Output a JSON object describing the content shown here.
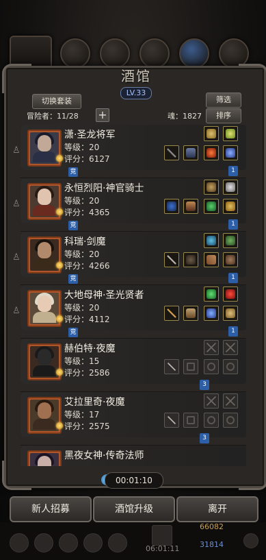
{
  "header": {
    "title": "酒馆",
    "level": "LV.33",
    "switch_outfit_label": "切换套装",
    "filter_label": "筛选",
    "sort_label": "排序",
    "adventurer_label": "冒险者：11/28",
    "soul_label": "魂：1827"
  },
  "heroes": [
    {
      "name": "潇·圣龙将军",
      "level": "等级：20",
      "score": "评分：6127",
      "tag": "竞",
      "badge": "1"
    },
    {
      "name": "永恒烈阳·神官骑士",
      "level": "等级：20",
      "score": "评分：4365",
      "tag": "竞",
      "badge": "1"
    },
    {
      "name": "科瑞·剑魔",
      "level": "等级：20",
      "score": "评分：4266",
      "tag": "竞",
      "badge": "1"
    },
    {
      "name": "大地母神·圣光贤者",
      "level": "等级：20",
      "score": "评分：4112",
      "tag": "竞",
      "badge": "1"
    },
    {
      "name": "赫伯特·夜魔",
      "level": "等级：15",
      "score": "评分：2586",
      "tag": "",
      "badge": "3"
    },
    {
      "name": "艾拉里奇·夜魔",
      "level": "等级：17",
      "score": "评分：2575",
      "tag": "",
      "badge": "3"
    },
    {
      "name": "黑夜女神·传奇法师",
      "level": "",
      "score": "",
      "tag": "",
      "badge": ""
    }
  ],
  "timer": "00:01:10",
  "buttons": {
    "recruit": "新人招募",
    "upgrade": "酒馆升级",
    "leave": "离开"
  },
  "bottom_bar": {
    "gold": "66082",
    "time": "06:01:11",
    "gems": "31814"
  },
  "colors": {
    "accent_blue": "#2c5fa8",
    "portrait_frame": "#b0552a",
    "slot_gold": "#9a8a4a"
  }
}
